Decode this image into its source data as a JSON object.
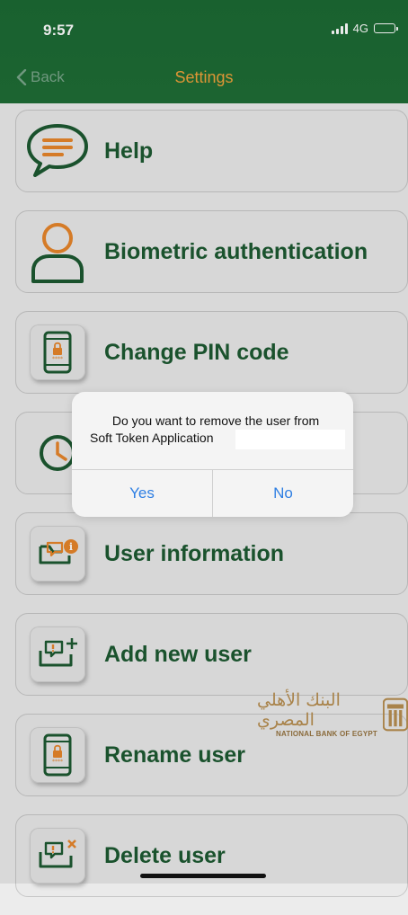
{
  "status_bar": {
    "time": "9:57",
    "network": "4G"
  },
  "nav": {
    "back_label": "Back",
    "title": "Settings"
  },
  "items": [
    {
      "label": "Help",
      "icon": "chat-icon"
    },
    {
      "label": "Biometric authentication",
      "icon": "user-icon"
    },
    {
      "label": "Change PIN code",
      "icon": "phone-lock-icon"
    },
    {
      "label": "",
      "icon": "clock-icon"
    },
    {
      "label": "User information",
      "icon": "user-info-icon"
    },
    {
      "label": "Add new user",
      "icon": "add-user-icon"
    },
    {
      "label": "Rename user",
      "icon": "phone-lock-icon"
    },
    {
      "label": "Delete user",
      "icon": "delete-user-icon"
    }
  ],
  "logo": {
    "arabic": "البنك الأهلي المصري",
    "english": "NATIONAL BANK OF EGYPT"
  },
  "dialog": {
    "message_line1": "Do you want to remove the user from",
    "message_line2": "Soft Token Application",
    "yes_label": "Yes",
    "no_label": "No"
  },
  "colors": {
    "header": "#1f6d36",
    "title": "#f0a23a",
    "label": "#1d5a31",
    "icon_orange": "#e8862b",
    "dialog_button": "#2f7fe3"
  }
}
